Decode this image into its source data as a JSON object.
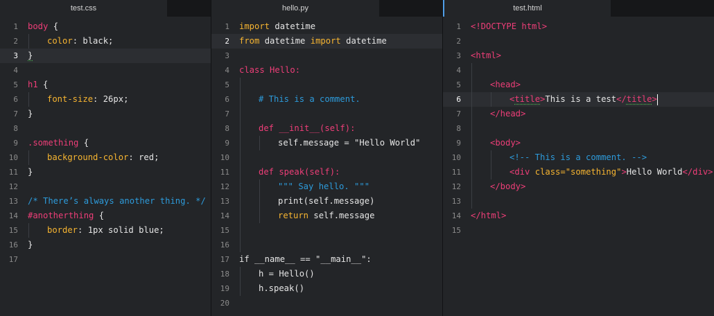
{
  "panes": [
    {
      "tab": "test.css",
      "current_line": 3,
      "lines": [
        {
          "n": "1",
          "parts": [
            {
              "t": "body",
              "c": "p"
            },
            {
              "t": " {",
              "c": "w"
            }
          ]
        },
        {
          "n": "2",
          "parts": [
            {
              "t": "color",
              "c": "k"
            },
            {
              "t": ": black;",
              "c": "w"
            }
          ]
        },
        {
          "n": "3",
          "parts": [
            {
              "t": "}",
              "c": "w",
              "sq": true
            }
          ]
        },
        {
          "n": "4",
          "parts": []
        },
        {
          "n": "5",
          "parts": [
            {
              "t": "h1",
              "c": "p"
            },
            {
              "t": " {",
              "c": "w"
            }
          ]
        },
        {
          "n": "6",
          "parts": [
            {
              "t": "font-size",
              "c": "k"
            },
            {
              "t": ": 26px;",
              "c": "w"
            }
          ]
        },
        {
          "n": "7",
          "parts": [
            {
              "t": "}",
              "c": "w"
            }
          ]
        },
        {
          "n": "8",
          "parts": []
        },
        {
          "n": "9",
          "parts": [
            {
              "t": ".something",
              "c": "p"
            },
            {
              "t": " {",
              "c": "w"
            }
          ]
        },
        {
          "n": "10",
          "parts": [
            {
              "t": "background-color",
              "c": "k"
            },
            {
              "t": ": red;",
              "c": "w"
            }
          ]
        },
        {
          "n": "11",
          "parts": [
            {
              "t": "}",
              "c": "w"
            }
          ]
        },
        {
          "n": "12",
          "parts": []
        },
        {
          "n": "13",
          "parts": [
            {
              "t": "/* There’s always another thing. */",
              "c": "c"
            }
          ]
        },
        {
          "n": "14",
          "parts": [
            {
              "t": "#anotherthing",
              "c": "p"
            },
            {
              "t": " {",
              "c": "w"
            }
          ]
        },
        {
          "n": "15",
          "parts": [
            {
              "t": "border",
              "c": "k"
            },
            {
              "t": ": 1px solid blue;",
              "c": "w"
            }
          ]
        },
        {
          "n": "16",
          "parts": [
            {
              "t": "}",
              "c": "w"
            }
          ]
        },
        {
          "n": "17",
          "parts": []
        }
      ]
    },
    {
      "tab": "hello.py",
      "current_line": 2,
      "lines": [
        {
          "n": "1",
          "parts": [
            {
              "t": "import",
              "c": "k"
            },
            {
              "t": " datetime",
              "c": "w"
            }
          ]
        },
        {
          "n": "2",
          "parts": [
            {
              "t": "from",
              "c": "k"
            },
            {
              "t": " datetime ",
              "c": "w"
            },
            {
              "t": "import",
              "c": "k"
            },
            {
              "t": " datetime",
              "c": "w"
            }
          ]
        },
        {
          "n": "3",
          "parts": []
        },
        {
          "n": "4",
          "parts": [
            {
              "t": "class Hello:",
              "c": "p"
            }
          ]
        },
        {
          "n": "5",
          "parts": []
        },
        {
          "n": "6",
          "parts": [
            {
              "t": "# This is a comment.",
              "c": "c"
            }
          ]
        },
        {
          "n": "7",
          "parts": []
        },
        {
          "n": "8",
          "parts": [
            {
              "t": "def __init__(self):",
              "c": "p"
            }
          ]
        },
        {
          "n": "9",
          "parts": [
            {
              "t": "self.message = \"Hello World\"",
              "c": "w"
            }
          ]
        },
        {
          "n": "10",
          "parts": []
        },
        {
          "n": "11",
          "parts": [
            {
              "t": "def speak(self):",
              "c": "p"
            }
          ]
        },
        {
          "n": "12",
          "parts": [
            {
              "t": "\"\"\" Say hello. \"\"\"",
              "c": "c"
            }
          ]
        },
        {
          "n": "13",
          "parts": [
            {
              "t": "print(self.message)",
              "c": "w"
            }
          ]
        },
        {
          "n": "14",
          "parts": [
            {
              "t": "return",
              "c": "k"
            },
            {
              "t": " self.message",
              "c": "w"
            }
          ]
        },
        {
          "n": "15",
          "parts": []
        },
        {
          "n": "16",
          "parts": []
        },
        {
          "n": "17",
          "parts": [
            {
              "t": "if __name__ == \"__main__\":",
              "c": "w"
            }
          ]
        },
        {
          "n": "18",
          "parts": [
            {
              "t": "h = Hello()",
              "c": "w"
            }
          ]
        },
        {
          "n": "19",
          "parts": [
            {
              "t": "h.speak()",
              "c": "w"
            }
          ]
        },
        {
          "n": "20",
          "parts": []
        }
      ]
    },
    {
      "tab": "test.html",
      "current_line": 6,
      "lines": [
        {
          "n": "1",
          "parts": [
            {
              "t": "<!DOCTYPE html>",
              "c": "p"
            }
          ]
        },
        {
          "n": "2",
          "parts": []
        },
        {
          "n": "3",
          "parts": [
            {
              "t": "<html>",
              "c": "p"
            }
          ]
        },
        {
          "n": "4",
          "parts": []
        },
        {
          "n": "5",
          "parts": [
            {
              "t": "<head>",
              "c": "p"
            }
          ]
        },
        {
          "n": "6",
          "parts": [
            {
              "t": "<",
              "c": "p"
            },
            {
              "t": "title",
              "c": "p",
              "sq": true
            },
            {
              "t": ">",
              "c": "p"
            },
            {
              "t": "This is a test",
              "c": "w"
            },
            {
              "t": "</",
              "c": "p"
            },
            {
              "t": "title",
              "c": "p",
              "sq": true
            },
            {
              "t": ">",
              "c": "p"
            }
          ],
          "caret": true
        },
        {
          "n": "7",
          "parts": [
            {
              "t": "</head>",
              "c": "p"
            }
          ]
        },
        {
          "n": "8",
          "parts": []
        },
        {
          "n": "9",
          "parts": [
            {
              "t": "<body>",
              "c": "p"
            }
          ]
        },
        {
          "n": "10",
          "parts": [
            {
              "t": "<!-- This is a comment. -->",
              "c": "c"
            }
          ]
        },
        {
          "n": "11",
          "parts": [
            {
              "t": "<div ",
              "c": "p"
            },
            {
              "t": "class=",
              "c": "k"
            },
            {
              "t": "\"something\"",
              "c": "k"
            },
            {
              "t": ">",
              "c": "p"
            },
            {
              "t": "Hello World",
              "c": "w"
            },
            {
              "t": "</div>",
              "c": "p"
            }
          ]
        },
        {
          "n": "12",
          "parts": [
            {
              "t": "</body>",
              "c": "p"
            }
          ]
        },
        {
          "n": "13",
          "parts": []
        },
        {
          "n": "14",
          "parts": [
            {
              "t": "</html>",
              "c": "p"
            }
          ]
        },
        {
          "n": "15",
          "parts": []
        }
      ]
    }
  ]
}
